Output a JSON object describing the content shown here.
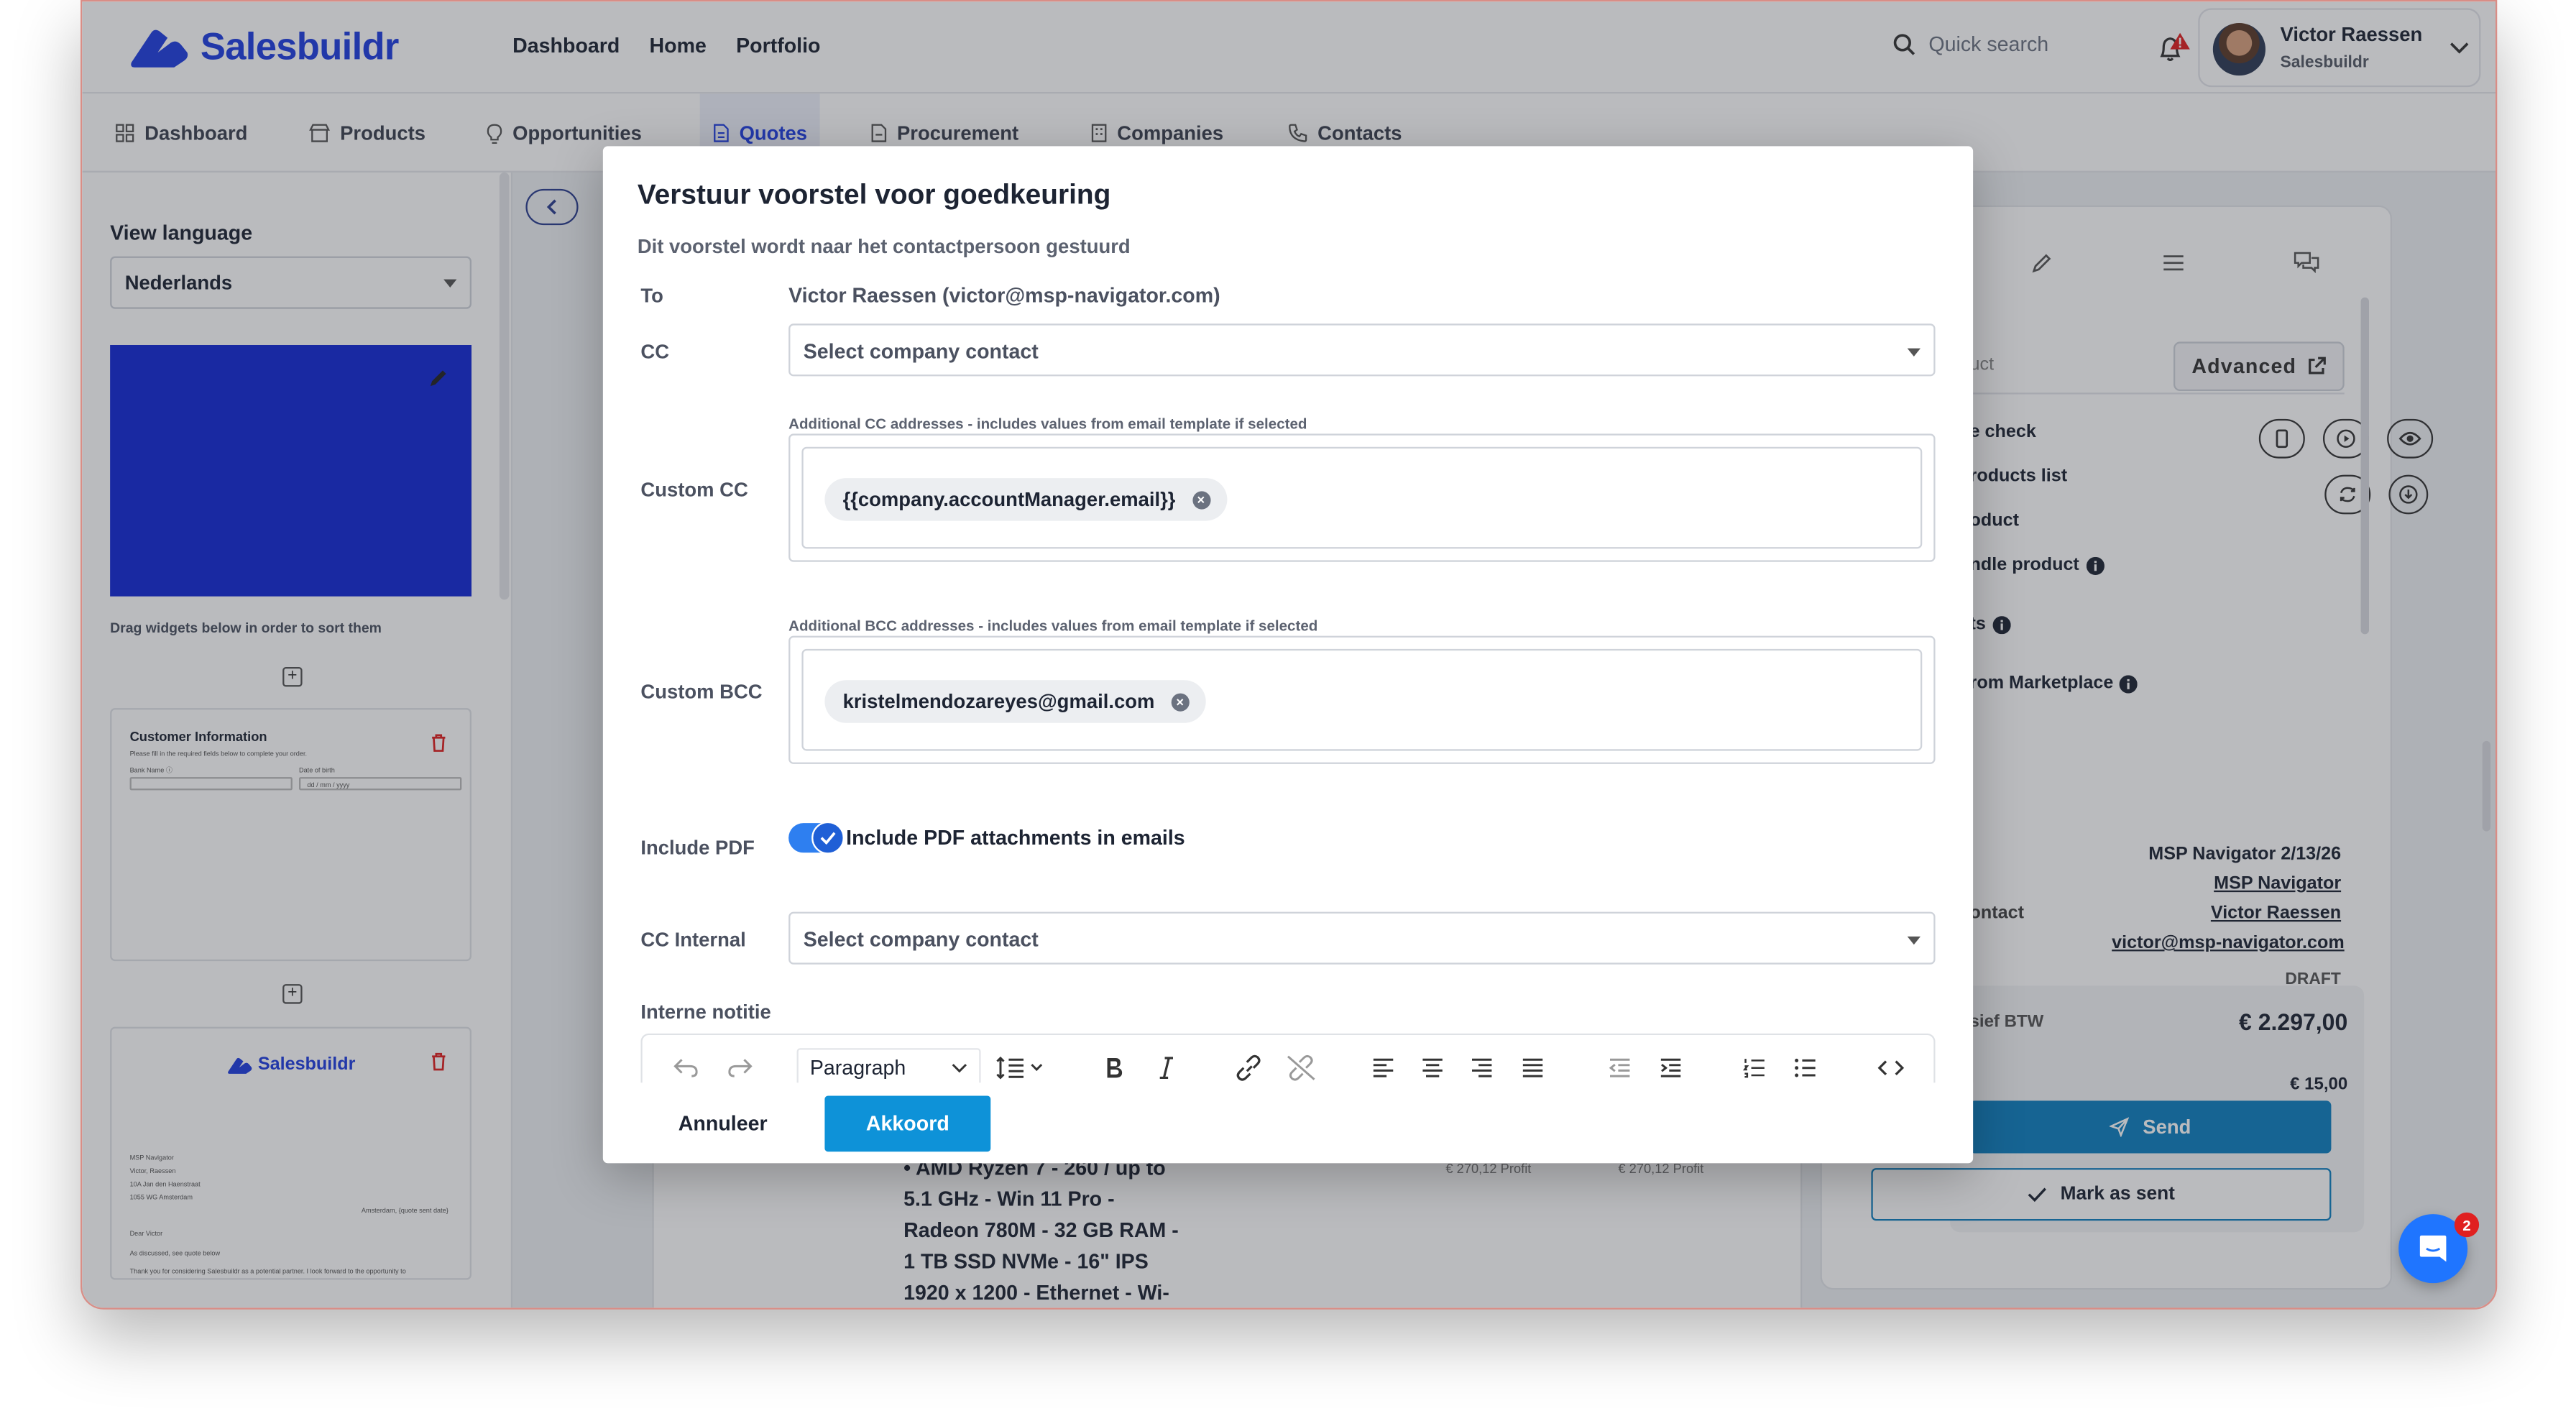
{
  "app": {
    "brand": "Salesbuildr",
    "brand_color": "#1f3ee0",
    "top_nav": [
      "Dashboard",
      "Home",
      "Portfolio"
    ],
    "search_placeholder": "Quick search",
    "user": {
      "name": "Victor Raessen",
      "company": "Salesbuildr"
    },
    "tabs": [
      "Dashboard",
      "Products",
      "Opportunities",
      "Quotes",
      "Procurement",
      "Companies",
      "Contacts"
    ],
    "active_tab": "Quotes"
  },
  "left_panel": {
    "view_language_label": "View language",
    "language_value": "Nederlands",
    "drag_hint": "Drag widgets below in order to sort them",
    "customer_card": {
      "title": "Customer Information",
      "line": "Please fill in the required fields below to complete your order.",
      "field1": "Bank Name ⓘ",
      "field2": "Date of birth",
      "date_placeholder": "dd / mm / yyyy"
    },
    "letter_card": {
      "brand": "Salesbuildr",
      "address": [
        "MSP Navigator",
        "Victor, Raessen",
        "10A Jan den Haenstraat",
        "1055 WG Amsterdam"
      ],
      "place_date": "Amsterdam, {quote sent date}",
      "greeting": "Dear Victor",
      "body1": "As discussed, see quote below",
      "body2": "Thank you for considering Salesbuildr as a potential partner. I look forward to the opportunity to"
    }
  },
  "center": {
    "doc_lines": [
      "• AMD Ryzen 7 - 260 / up to",
      "5.1 GHz - Win 11 Pro -",
      "Radeon 780M - 32 GB RAM -",
      "1 TB SSD NVMe - 16\" IPS",
      "1920 x 1200 - Ethernet - Wi-"
    ],
    "profit1": "€ 270,12 Profit",
    "profit2": "€ 270,12 Profit"
  },
  "right_panel": {
    "search_placeholder": "uct",
    "advanced_label": "Advanced",
    "items": [
      "e check",
      "roducts list",
      "oduct",
      "ndle product",
      "ts",
      "rom Marketplace"
    ],
    "quote_name": "MSP Navigator 2/13/26",
    "company_link": "MSP Navigator",
    "contact_label": "ontact",
    "contact_name": "Victor Raessen",
    "contact_email": "victor@msp-navigator.com",
    "status": "DRAFT",
    "total_label": "sief BTW",
    "total_value": "€ 2.297,00",
    "sub_value": "€ 15,00",
    "send_label": "Send",
    "mark_sent_label": "Mark as sent"
  },
  "chat_badge": "2",
  "modal": {
    "title": "Verstuur voorstel voor goedkeuring",
    "subtitle": "Dit voorstel wordt naar het contactpersoon gestuurd",
    "to_label": "To",
    "to_value": "Victor Raessen (victor@msp-navigator.com)",
    "cc_label": "CC",
    "cc_placeholder": "Select company contact",
    "cc_hint": "Additional CC addresses - includes values from email template if selected",
    "custom_cc_label": "Custom CC",
    "custom_cc_tag": "{{company.accountManager.email}}",
    "bcc_hint": "Additional BCC addresses - includes values from email template if selected",
    "custom_bcc_label": "Custom BCC",
    "custom_bcc_tag": "kristelmendozareyes@gmail.com",
    "include_pdf_label": "Include PDF",
    "include_pdf_text": "Include PDF attachments in emails",
    "cc_internal_label": "CC Internal",
    "cc_internal_placeholder": "Select company contact",
    "note_label": "Interne notitie",
    "paragraph_value": "Paragraph",
    "cancel_label": "Annuleer",
    "ok_label": "Akkoord",
    "ok_color": "#0e92d8"
  }
}
